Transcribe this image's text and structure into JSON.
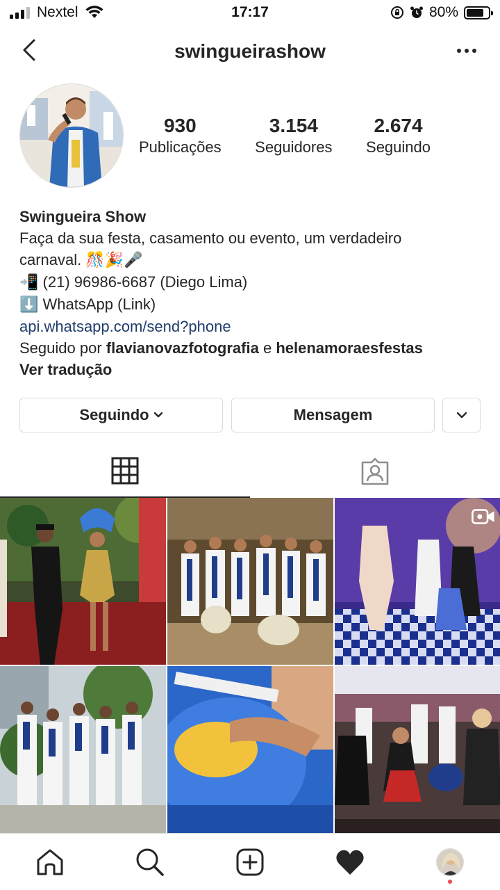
{
  "status_bar": {
    "carrier": "Nextel",
    "time": "17:17",
    "battery": "80%",
    "battery_level": 0.8
  },
  "header": {
    "username": "swingueirashow",
    "back_icon": "chevron-left-icon",
    "more_icon": "more-horizontal-icon"
  },
  "profile": {
    "stats": [
      {
        "value": "930",
        "label": "Publicações"
      },
      {
        "value": "3.154",
        "label": "Seguidores"
      },
      {
        "value": "2.674",
        "label": "Seguindo"
      }
    ],
    "name": "Swingueira Show",
    "bio_line1": "Faça da sua festa, casamento ou evento, um verdadeiro",
    "bio_line2": "carnaval.",
    "bio_line2_emoji": "🎊🎉🎤",
    "phone_emoji": "📲",
    "phone": "(21) 96986-6687 (Diego Lima)",
    "whatsapp_emoji": "⬇️",
    "whatsapp": "WhatsApp (Link)",
    "link": "api.whatsapp.com/send?phone",
    "followed_by_prefix": "Seguido por",
    "followed_by_1": "flavianovazfotografia",
    "followed_by_and": "e",
    "followed_by_2": "helenamoraesfestas",
    "see_translation": "Ver tradução"
  },
  "actions": {
    "following_label": "Seguindo",
    "message_label": "Mensagem"
  },
  "tabs": [
    {
      "icon": "grid-icon",
      "active": true
    },
    {
      "icon": "tagged-icon",
      "active": false
    }
  ],
  "posts": [
    {
      "index": 1,
      "video": false
    },
    {
      "index": 2,
      "video": false
    },
    {
      "index": 3,
      "video": true
    },
    {
      "index": 4,
      "video": false
    },
    {
      "index": 5,
      "video": false
    },
    {
      "index": 6,
      "video": false
    }
  ],
  "bottom_nav": [
    "home-icon",
    "search-icon",
    "new-post-icon",
    "activity-icon",
    "profile-avatar"
  ],
  "colors": {
    "text": "#262626",
    "link": "#1f3b69",
    "border": "#dbdbdb",
    "notification_dot": "#ed4956"
  }
}
